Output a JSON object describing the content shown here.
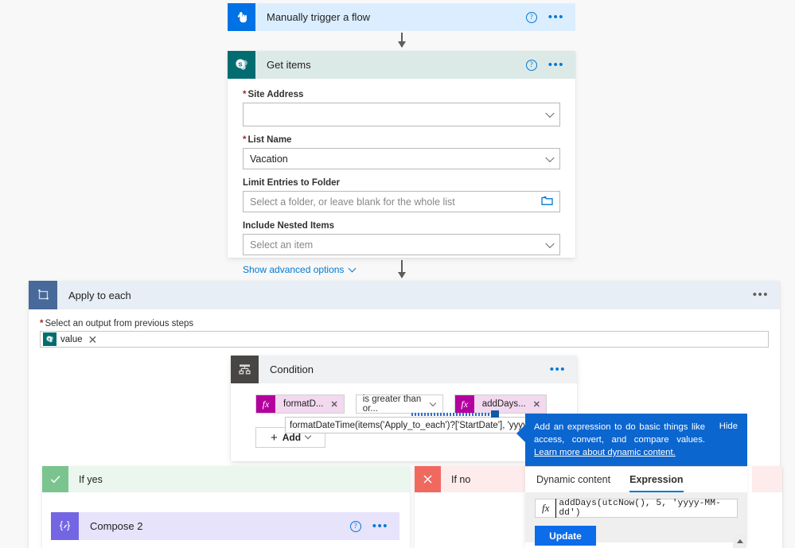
{
  "trigger": {
    "title": "Manually trigger a flow",
    "icon": "hand-pointer-icon",
    "help_label": "?",
    "more_label": "•••"
  },
  "get_items": {
    "title": "Get items",
    "icon": "sharepoint-icon",
    "help_label": "?",
    "more_label": "•••",
    "fields": [
      {
        "label": "Site Address",
        "required": true,
        "value": "",
        "placeholder": "",
        "control": "dropdown"
      },
      {
        "label": "List Name",
        "required": true,
        "value": "Vacation",
        "placeholder": "",
        "control": "dropdown"
      },
      {
        "label": "Limit Entries to Folder",
        "required": false,
        "value": "",
        "placeholder": "Select a folder, or leave blank for the whole list",
        "control": "folder-picker"
      },
      {
        "label": "Include Nested Items",
        "required": false,
        "value": "",
        "placeholder": "Select an item",
        "control": "dropdown"
      }
    ],
    "advanced_link": "Show advanced options"
  },
  "apply_to_each": {
    "title": "Apply to each",
    "icon": "loop-icon",
    "more_label": "•••",
    "output_label": "Select an output from previous steps",
    "output_required": true,
    "output_token": "value",
    "output_token_icon": "sharepoint-icon",
    "output_token_remove": "✕"
  },
  "condition": {
    "title": "Condition",
    "icon": "condition-branch-icon",
    "more_label": "•••",
    "left_token": {
      "fx": "fx",
      "label": "formatD...",
      "remove": "✕"
    },
    "operator": "is greater than or...",
    "right_token": {
      "fx": "fx",
      "label": "addDays...",
      "remove": "✕"
    },
    "inline_expression": "formatDateTime(items('Apply_to_each')?['StartDate'], 'yyyy-MM-dd')",
    "add_button": "Add"
  },
  "branches": {
    "yes": {
      "title": "If yes",
      "icon": "checkmark-icon"
    },
    "no": {
      "title": "If no",
      "icon": "cross-icon"
    }
  },
  "compose": {
    "title": "Compose 2",
    "icon": "compose-braces-icon",
    "help_label": "?",
    "more_label": "•••"
  },
  "callout": {
    "text_before_link": "Add an expression to do basic things like access, convert, and compare values. ",
    "link_text": "Learn more about dynamic content.",
    "hide_label": "Hide"
  },
  "dynamic_panel": {
    "tabs": [
      {
        "label": "Dynamic content",
        "active": false
      },
      {
        "label": "Expression",
        "active": true
      }
    ],
    "expression_fx": "fx",
    "expression_value": "addDays(utcNow(), 5, 'yyyy-MM-dd')",
    "update_button": "Update"
  },
  "colors": {
    "trigger_blue": "#0072e5",
    "sharepoint_teal": "#036c70",
    "loop_slate": "#486a9a",
    "condition_gray": "#484644",
    "compose_purple": "#7466e3",
    "yes_green": "#7bc490",
    "no_red": "#f0695f",
    "accent_blue": "#0078d4",
    "token_magenta": "#b4009e",
    "callout_blue": "#0b66d0"
  }
}
